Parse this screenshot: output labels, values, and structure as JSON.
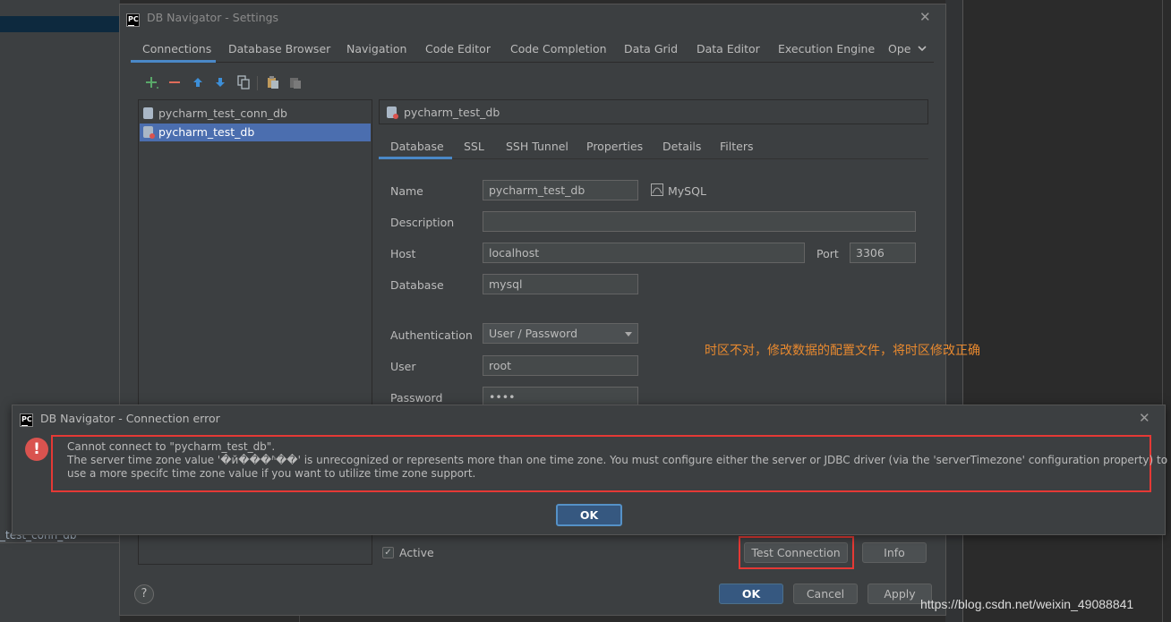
{
  "ide": {
    "list_tail": "_test_conn_db"
  },
  "settings": {
    "title": "DB Navigator - Settings",
    "logo": "PC",
    "close_icon": "✕",
    "tabs": [
      "Connections",
      "Database Browser",
      "Navigation",
      "Code Editor",
      "Code Completion",
      "Data Grid",
      "Data Editor",
      "Execution Engine",
      "Ope"
    ],
    "tabs_overflow_icon": "chevron-down-icon",
    "toolbar_icons": [
      "add-icon",
      "remove-icon",
      "move-up-icon",
      "move-down-icon",
      "copy-icon",
      "paste-icon",
      "paste-disabled-icon"
    ],
    "connections": [
      "pycharm_test_conn_db",
      "pycharm_test_db"
    ],
    "selected_connection": "pycharm_test_db",
    "detail_title": "pycharm_test_db",
    "subtabs": [
      "Database",
      "SSL",
      "SSH Tunnel",
      "Properties",
      "Details",
      "Filters"
    ],
    "form": {
      "name_label": "Name",
      "name_value": "pycharm_test_db",
      "db_type": "MySQL",
      "description_label": "Description",
      "description_value": "",
      "host_label": "Host",
      "host_value": "localhost",
      "port_label": "Port",
      "port_value": "3306",
      "database_label": "Database",
      "database_value": "mysql",
      "auth_label": "Authentication",
      "auth_value": "User / Password",
      "user_label": "User",
      "user_value": "root",
      "password_label": "Password",
      "password_value": "••••"
    },
    "active_label": "Active",
    "test_connection_label": "Test Connection",
    "info_label": "Info",
    "ok_label": "OK",
    "cancel_label": "Cancel",
    "apply_label": "Apply",
    "help_label": "?"
  },
  "annotation": "时区不对，修改数据的配置文件，将时区修改正确",
  "error_dialog": {
    "title": "DB Navigator - Connection error",
    "logo": "PC",
    "close_icon": "✕",
    "icon_glyph": "!",
    "line1": "Cannot connect to \"pycharm_test_db\".",
    "line2": "The server time zone value '�й���ʱ��' is unrecognized or represents more than one time zone. You must configure either the server or JDBC driver (via the 'serverTimezone' configuration property) to",
    "line3": "use a more specifc time zone value if you want to utilize time zone support.",
    "ok_label": "OK"
  },
  "watermark": "https://blog.csdn.net/weixin_49088841",
  "colors": {
    "accent": "#4a88c7",
    "selection": "#4b6eaf",
    "error_red": "#e53935",
    "annotation": "#e8892f"
  }
}
